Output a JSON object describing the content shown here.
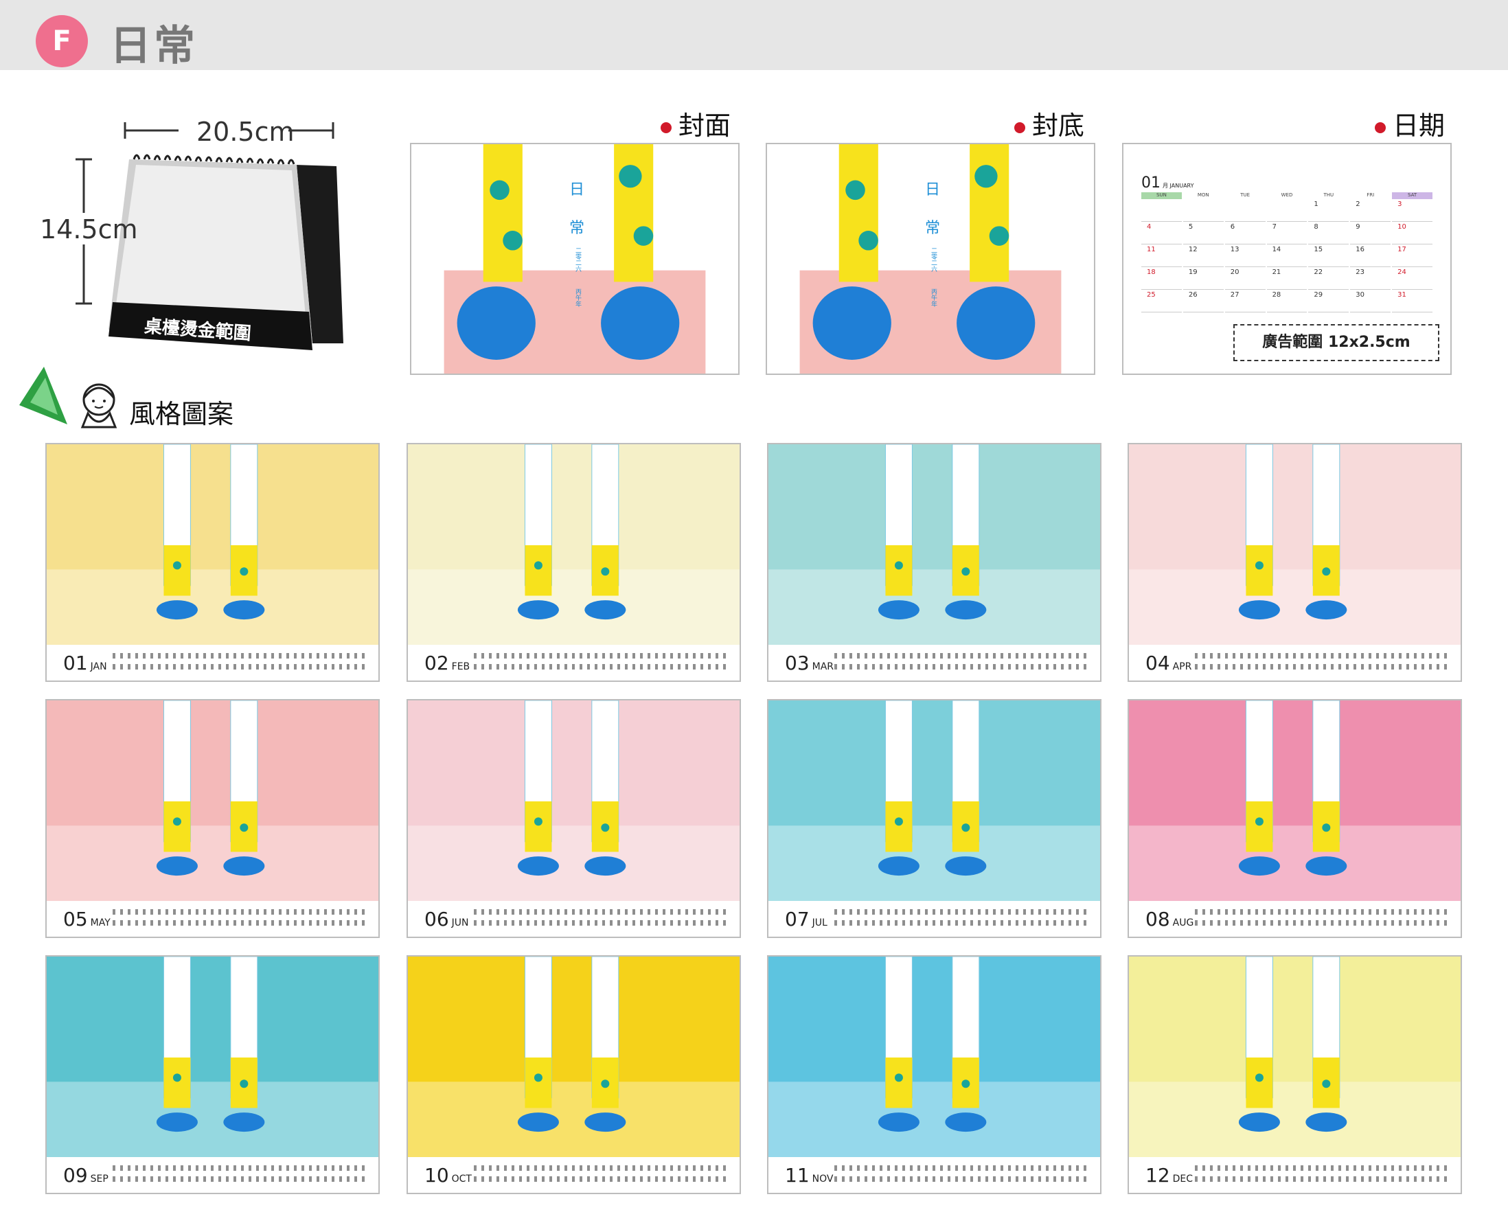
{
  "header": {
    "badge": "F",
    "title": "日常"
  },
  "desk": {
    "width": "20.5cm",
    "height": "14.5cm",
    "stamp_label": "桌檯燙金範圍"
  },
  "previews": {
    "cover_label": "封面",
    "back_label": "封底",
    "date_label": "日期",
    "cover_text": {
      "title1": "日",
      "title2": "常",
      "sub1": "二零二六",
      "sub2": "丙午年"
    }
  },
  "date_page": {
    "month_num": "01",
    "month_name": "月 JANUARY",
    "weekdays": [
      "SUN",
      "MON",
      "TUE",
      "WED",
      "THU",
      "FRI",
      "SAT"
    ],
    "rows": [
      [
        "",
        "",
        "",
        "",
        "1",
        "2",
        "3"
      ],
      [
        "4",
        "5",
        "6",
        "7",
        "8",
        "9",
        "10"
      ],
      [
        "11",
        "12",
        "13",
        "14",
        "15",
        "16",
        "17"
      ],
      [
        "18",
        "19",
        "20",
        "21",
        "22",
        "23",
        "24"
      ],
      [
        "25",
        "26",
        "27",
        "28",
        "29",
        "30",
        "31"
      ]
    ],
    "ad_label": "廣告範圍 12x2.5cm"
  },
  "style_label": "風格圖案",
  "months": [
    {
      "num": "01",
      "name": "JAN",
      "bg": "#f6e08e"
    },
    {
      "num": "02",
      "name": "FEB",
      "bg": "#f5f0c8"
    },
    {
      "num": "03",
      "name": "MAR",
      "bg": "#9fd9d8"
    },
    {
      "num": "04",
      "name": "APR",
      "bg": "#f7dada"
    },
    {
      "num": "05",
      "name": "MAY",
      "bg": "#f4b9b9"
    },
    {
      "num": "06",
      "name": "JUN",
      "bg": "#f5cfd5"
    },
    {
      "num": "07",
      "name": "JUL",
      "bg": "#7ccfda"
    },
    {
      "num": "08",
      "name": "AUG",
      "bg": "#ee8fae"
    },
    {
      "num": "09",
      "name": "SEP",
      "bg": "#5cc3cf"
    },
    {
      "num": "10",
      "name": "OCT",
      "bg": "#f5d21a"
    },
    {
      "num": "11",
      "name": "NOV",
      "bg": "#5dc4e0"
    },
    {
      "num": "12",
      "name": "DEC",
      "bg": "#f3ef9a"
    }
  ],
  "colors": {
    "badge": "#ef6f8e",
    "accent_red": "#d11a2a",
    "sock_yellow": "#f7e21c",
    "dot_teal": "#1aa49a",
    "shoe_blue": "#1f7fd6"
  }
}
